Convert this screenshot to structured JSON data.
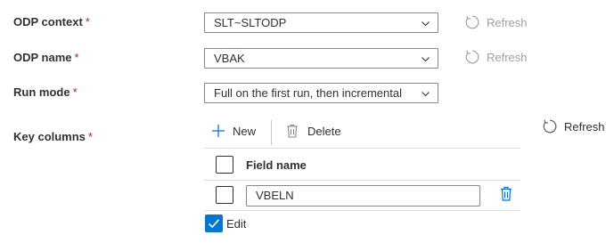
{
  "form": {
    "odp_context": {
      "label": "ODP context",
      "required": "*",
      "value": "SLT~SLTODP",
      "refresh": "Refresh"
    },
    "odp_name": {
      "label": "ODP name",
      "required": "*",
      "value": "VBAK",
      "refresh": "Refresh"
    },
    "run_mode": {
      "label": "Run mode",
      "required": "*",
      "value": "Full on the first run, then incremental"
    },
    "key_columns": {
      "label": "Key columns",
      "required": "*",
      "new_label": "New",
      "delete_label": "Delete",
      "refresh": "Refresh",
      "column_header": "Field name",
      "rows": [
        {
          "value": "VBELN"
        }
      ],
      "edit_label": "Edit",
      "edit_checked": true
    }
  },
  "colors": {
    "accent": "#0078d4",
    "required": "#a4262c",
    "disabled_text": "#a19f9d"
  },
  "icons": [
    "chevron-down-icon",
    "refresh-icon",
    "plus-icon",
    "trash-icon",
    "checkmark-icon"
  ]
}
